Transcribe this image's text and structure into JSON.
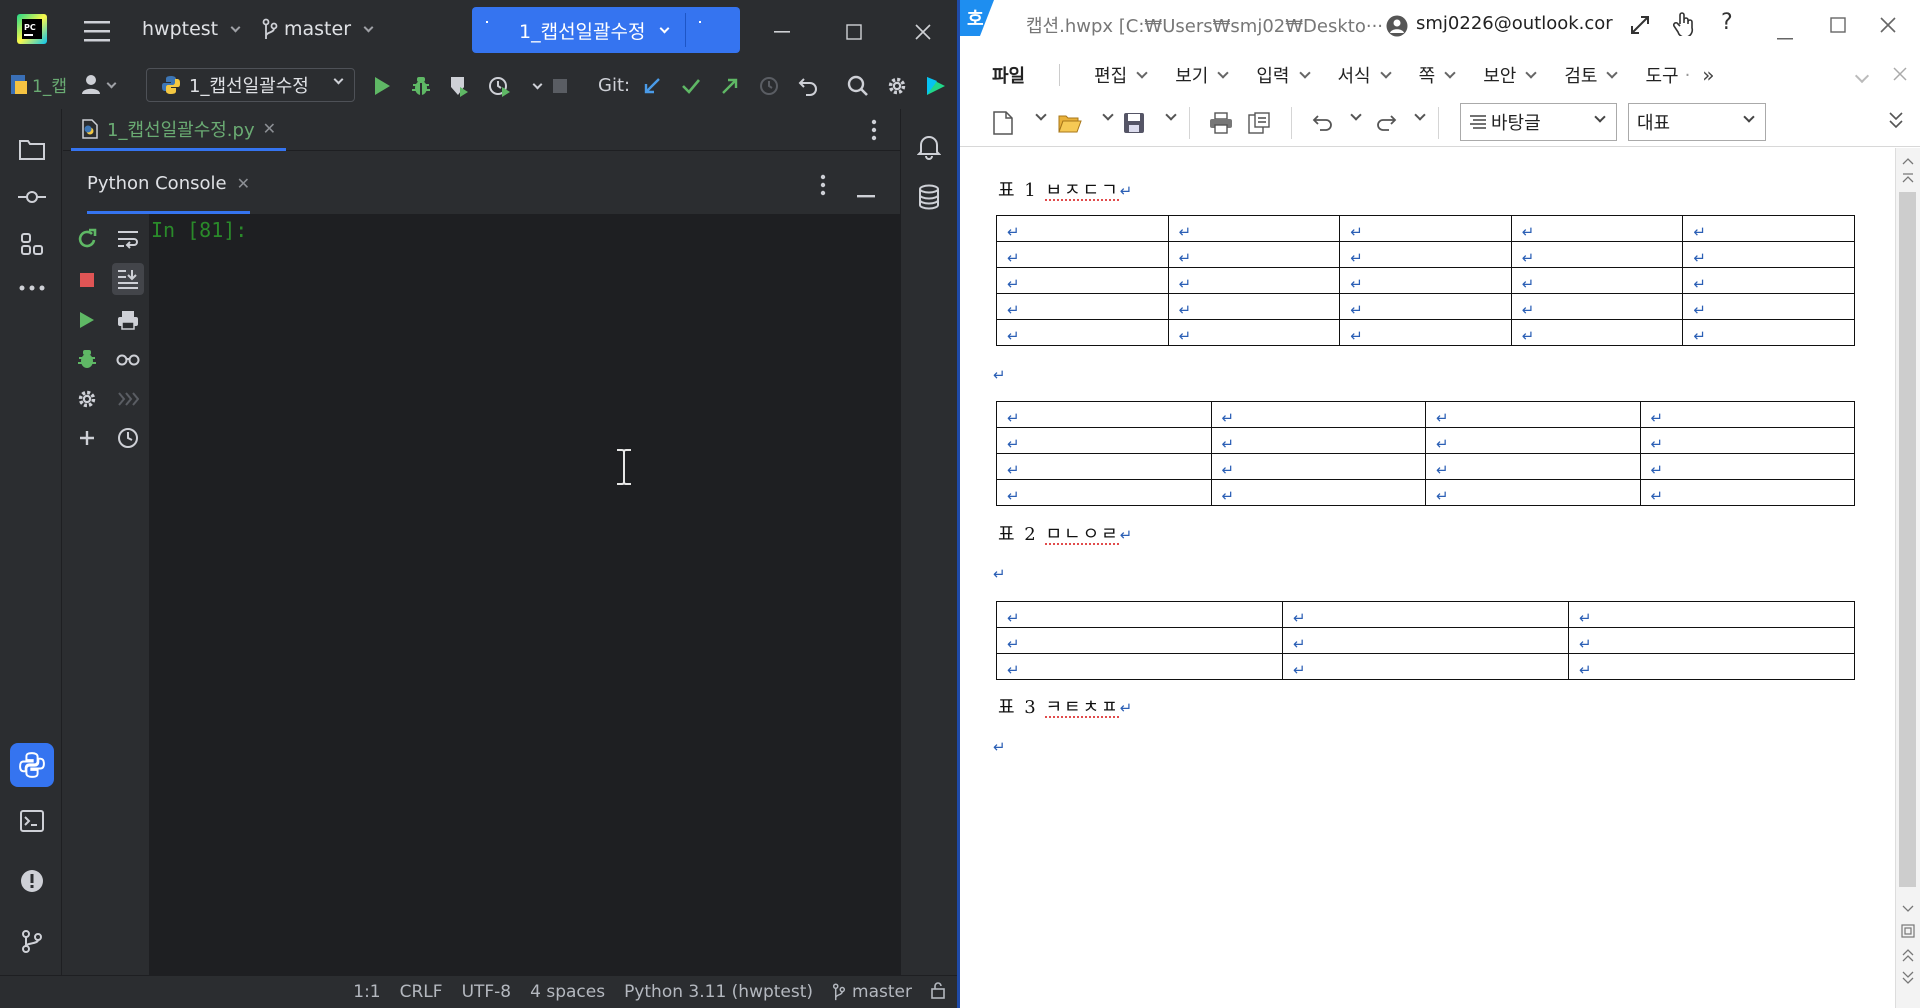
{
  "ide": {
    "project": "hwptest",
    "branch": "master",
    "run_config": "1_캡선일괄수정",
    "config_box": "1_캡선일괄수정",
    "project_chip": "1_캡",
    "git_label": "Git:",
    "editor_tab": "1_캡선일괄수정.py",
    "console_tab": "Python Console",
    "prompt": "In [81]:",
    "status": {
      "position": "1:1",
      "line_sep": "CRLF",
      "encoding": "UTF-8",
      "indent": "4 spaces",
      "interpreter": "Python 3.11 (hwptest)",
      "branch": "master"
    },
    "colors": {
      "accent": "#3574f0",
      "bg": "#2b2d30",
      "console_bg": "#1e1f22",
      "prompt": "#2a8a2a",
      "run_green": "#5fb865"
    }
  },
  "hwp": {
    "title": "캡션.hwpx [C:₩Users₩smj02₩Deskto···",
    "account": "smj0226@outlook.cor",
    "menus": [
      "파일",
      "편집",
      "보기",
      "입력",
      "서식",
      "쪽",
      "보안",
      "검토",
      "도구"
    ],
    "style_select": "바탕글",
    "font_select": "대표",
    "doc": {
      "captions": [
        {
          "prefix": "표 1 ",
          "label": "ㅂㅈㄷㄱ"
        },
        {
          "prefix": "표 2 ",
          "label": "ㅁㄴㅇㄹ"
        },
        {
          "prefix": "표 3 ",
          "label": "ㅋㅌㅊㅍ"
        }
      ],
      "return_mark": "↵",
      "tables": [
        {
          "rows": 5,
          "cols": 5
        },
        {
          "rows": 4,
          "cols": 4
        },
        {
          "rows": 3,
          "cols": 3
        }
      ]
    }
  }
}
